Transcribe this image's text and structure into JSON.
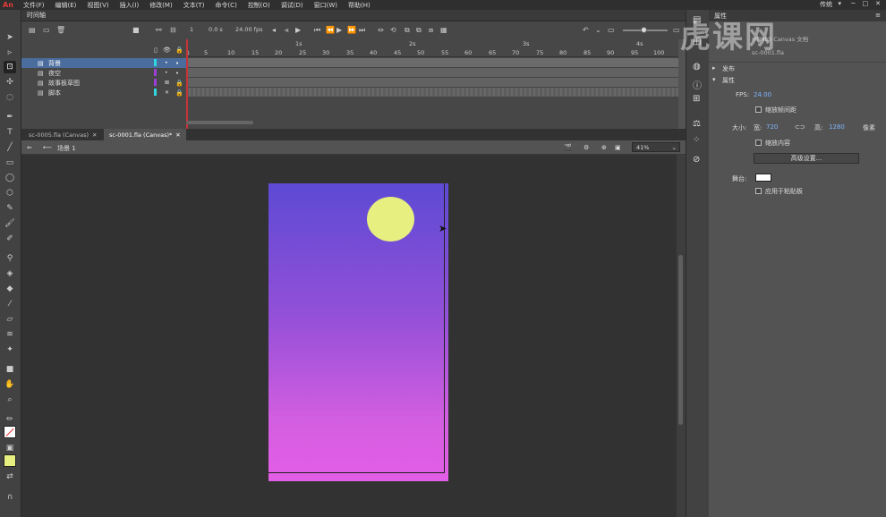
{
  "menu": {
    "logo": "An",
    "items": [
      "文件(F)",
      "编辑(E)",
      "视图(V)",
      "插入(I)",
      "修改(M)",
      "文本(T)",
      "命令(C)",
      "控制(O)",
      "调试(D)",
      "窗口(W)",
      "帮助(H)"
    ],
    "workspace": "传统"
  },
  "timeline": {
    "title": "时间轴",
    "frame_current": "1",
    "time": "0.0 s",
    "fps": "24.00 fps",
    "seconds": [
      "1s",
      "2s",
      "3s",
      "4s"
    ],
    "frame_numbers": [
      "1",
      "5",
      "10",
      "15",
      "20",
      "25",
      "30",
      "35",
      "40",
      "45",
      "50",
      "55",
      "60",
      "65",
      "70",
      "75",
      "80",
      "85",
      "90",
      "95",
      "100"
    ],
    "layers": [
      {
        "name": "背景",
        "color": "#2fd8e0",
        "selected": true
      },
      {
        "name": "夜空",
        "color": "#9b3fd6",
        "selected": false
      },
      {
        "name": "故事板草图",
        "color": "#9b3fd6",
        "selected": false
      },
      {
        "name": "脚本",
        "color": "#2fd8e0",
        "selected": false
      }
    ]
  },
  "documents": {
    "tabs": [
      {
        "label": "sc-0005.fla (Canvas)",
        "active": false
      },
      {
        "label": "sc-0001.fla (Canvas)*",
        "active": true
      }
    ],
    "scene": "场景 1",
    "zoom": "41%"
  },
  "stage": {
    "bg_top": "#5d4ad4",
    "bg_bottom": "#e35ee6",
    "moon_color": "#e6ef7f"
  },
  "properties": {
    "title": "属性",
    "doc_type": "HTML5 Canvas 文档",
    "doc_name": "sc-0001.fla",
    "publish": "发布",
    "attributes": "属性",
    "fps_label": "FPS:",
    "fps_value": "24.00",
    "scale_spans": "缩放帧间距",
    "size_label": "大小:",
    "width_label": "宽:",
    "width_value": "720",
    "height_label": "高:",
    "height_value": "1280",
    "unit": "像素",
    "scale_content": "缩放内容",
    "advanced": "高级设置...",
    "stage_label": "舞台:",
    "apply_pasteboard": "应用于粘贴板"
  },
  "watermark": "虎课网"
}
